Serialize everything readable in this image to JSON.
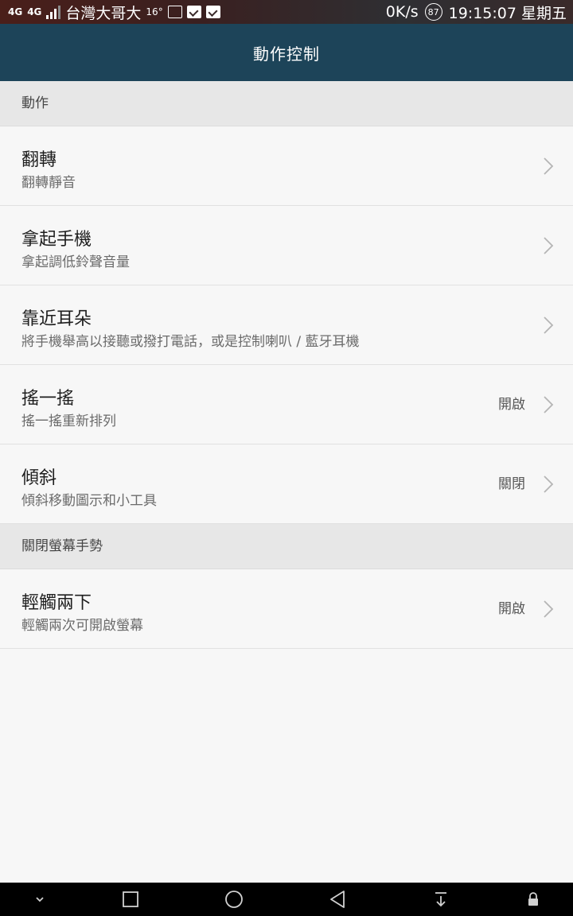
{
  "status_bar": {
    "network_left": "4G",
    "network_right": "4G",
    "carrier": "台灣大哥大",
    "temperature": "16°",
    "speed": "0K/s",
    "battery": "87",
    "time": "19:15:07 星期五",
    "icons": [
      "signal-icon",
      "image-icon",
      "briefcase-check-icon",
      "briefcase-check-icon"
    ]
  },
  "app_bar": {
    "title": "動作控制"
  },
  "sections": [
    {
      "header": "動作",
      "items": [
        {
          "title": "翻轉",
          "subtitle": "翻轉靜音",
          "value": ""
        },
        {
          "title": "拿起手機",
          "subtitle": "拿起調低鈴聲音量",
          "value": ""
        },
        {
          "title": "靠近耳朵",
          "subtitle": "將手機舉高以接聽或撥打電話，或是控制喇叭 / 藍牙耳機",
          "value": ""
        },
        {
          "title": "搖一搖",
          "subtitle": "搖一搖重新排列",
          "value": "開啟"
        },
        {
          "title": "傾斜",
          "subtitle": "傾斜移動圖示和小工具",
          "value": "關閉"
        }
      ]
    },
    {
      "header": "關閉螢幕手勢",
      "items": [
        {
          "title": "輕觸兩下",
          "subtitle": "輕觸兩次可開啟螢幕",
          "value": "開啟"
        }
      ]
    }
  ],
  "nav_bar": {
    "icons": [
      "collapse-down-icon",
      "recent-apps-icon",
      "home-icon",
      "back-icon",
      "notification-pull-icon",
      "lock-icon"
    ]
  },
  "colors": {
    "app_bar": "#1d4459",
    "section_header": "#e7e7e7",
    "background": "#f7f7f7"
  }
}
